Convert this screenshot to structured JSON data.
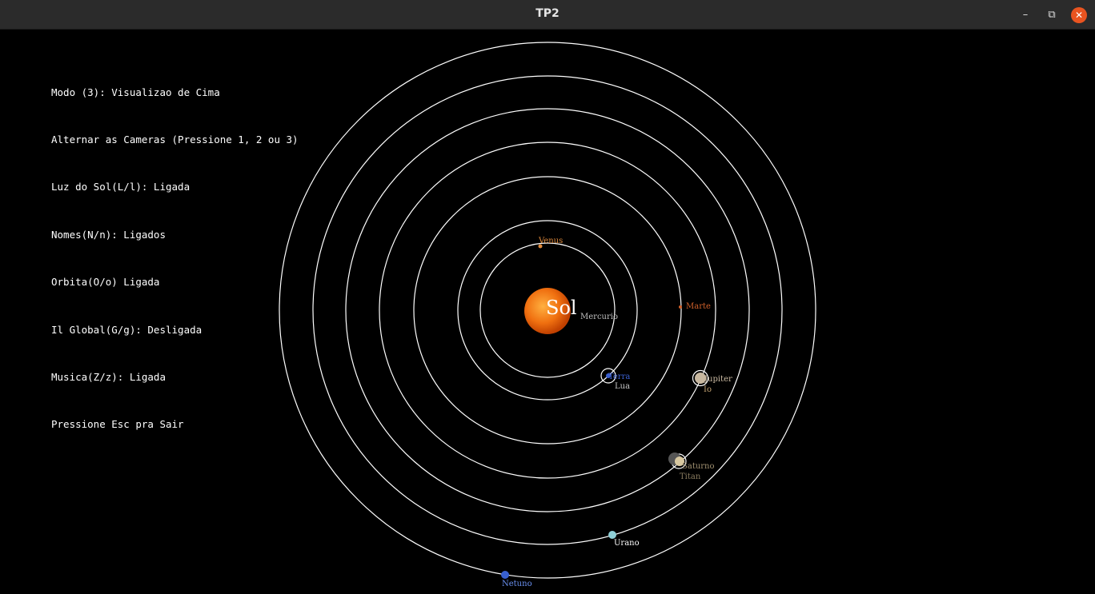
{
  "window": {
    "title": "TP2"
  },
  "controls": {
    "minimize": "–",
    "maximize": "⧉",
    "close": "✕"
  },
  "hud": {
    "lines": [
      "Modo (3): Visualizao de Cima",
      "Alternar as Cameras (Pressione 1, 2 ou 3)",
      "Luz do Sol(L/l): Ligada",
      "Nomes(N/n): Ligados",
      "Orbita(O/o) Ligada",
      "Il Global(G/g): Desligada",
      "Musica(Z/z): Ligada",
      "Pressione Esc pra Sair"
    ]
  },
  "scene": {
    "sun_label": "Sol",
    "bodies": [
      {
        "name": "Mercurio",
        "color": "#bfbfbf"
      },
      {
        "name": "Venus",
        "color": "#e08a3c"
      },
      {
        "name": "Terra",
        "color": "#3a5fd0"
      },
      {
        "name": "Lua",
        "color": "#c8c8c8"
      },
      {
        "name": "Marte",
        "color": "#d0602a"
      },
      {
        "name": "Jupiter",
        "color": "#c8b8a0"
      },
      {
        "name": "Io",
        "color": "#c0a070"
      },
      {
        "name": "Saturno",
        "color": "#d8c8a0"
      },
      {
        "name": "Titan",
        "color": "#a09070"
      },
      {
        "name": "Urano",
        "color": "#8fd0d8"
      },
      {
        "name": "Netuno",
        "color": "#3860d0"
      }
    ],
    "sun_color": "#f07a10"
  }
}
